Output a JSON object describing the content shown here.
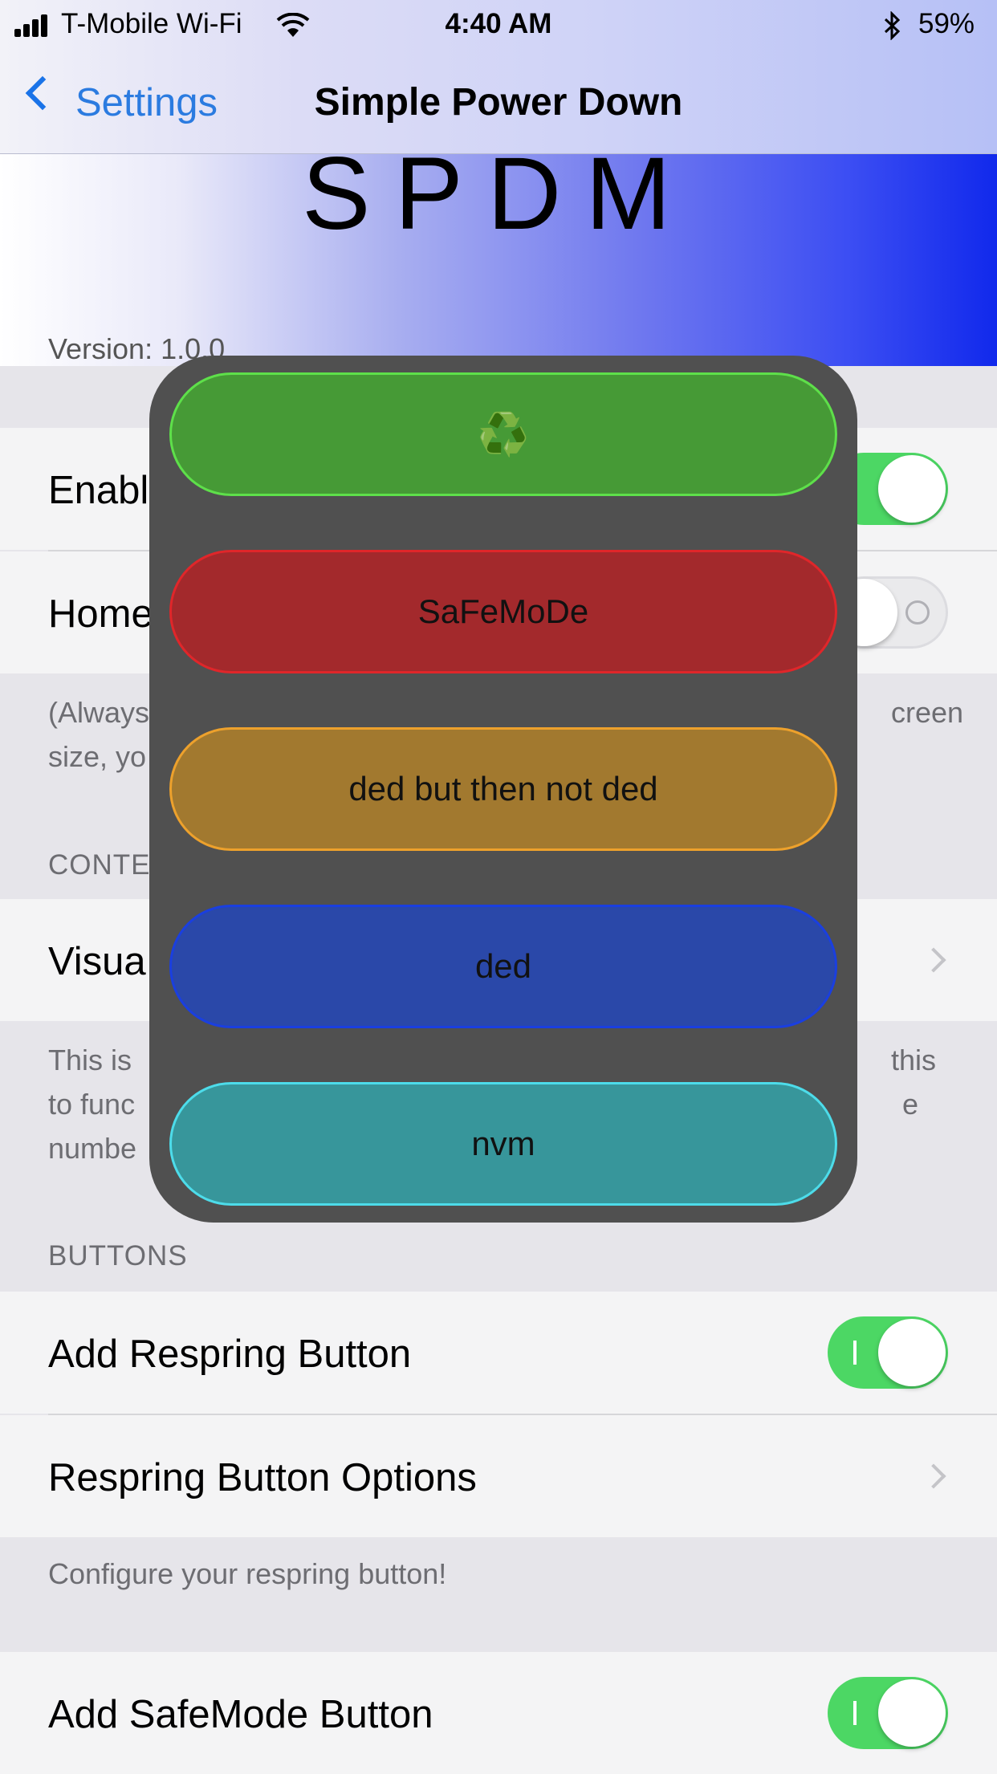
{
  "status_bar": {
    "carrier": "T-Mobile Wi-Fi",
    "time": "4:40 AM",
    "battery": "59%"
  },
  "nav": {
    "back_label": "Settings",
    "title": "Simple Power Down"
  },
  "header": {
    "logo_text": "SPDM",
    "version": "Version: 1.0.0"
  },
  "rows": {
    "enable_label": "Enabl",
    "home_label": "Home",
    "visual_label": "Visua",
    "add_respring": "Add Respring Button",
    "respring_options": "Respring Button Options",
    "add_safemode": "Add SafeMode Button"
  },
  "footers": {
    "home_footer_line1": "(Always",
    "home_footer_line1_right": "creen",
    "home_footer_line2": "size, yo",
    "visual_footer_line1": "This is",
    "visual_footer_line1_right": "this",
    "visual_footer_line2": "to func",
    "visual_footer_line2_right": "e",
    "visual_footer_line3": "numbe",
    "respring_footer": "Configure your respring button!"
  },
  "sections": {
    "content": "CONTE",
    "buttons": "BUTTONS"
  },
  "toggles": {
    "enable": true,
    "home": false,
    "add_respring": true,
    "add_safemode": true
  },
  "menu": {
    "buttons": [
      {
        "label": "♻️",
        "fill": "#469a36",
        "border": "#5ee04a"
      },
      {
        "label": "SaFeMoDe",
        "fill": "#a3292c",
        "border": "#e0262a"
      },
      {
        "label": "ded but then not ded",
        "fill": "#a2792f",
        "border": "#eda12c"
      },
      {
        "label": "ded",
        "fill": "#2a48a9",
        "border": "#1a3fe0"
      },
      {
        "label": "nvm",
        "fill": "#37969b",
        "border": "#4ddcea"
      }
    ]
  }
}
